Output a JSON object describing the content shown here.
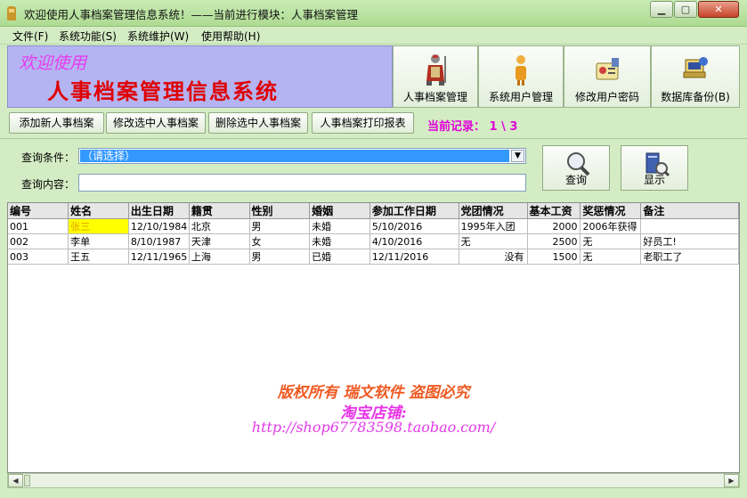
{
  "window": {
    "title": "欢迎使用人事档案管理信息系统！——当前进行模块：人事档案管理",
    "min_label": "▁",
    "max_label": "▢",
    "close_label": "✕"
  },
  "menu": [
    "文件(F)",
    "系统功能(S)",
    "系统维护(W)",
    "使用帮助(H)"
  ],
  "banner": {
    "welcome": "欢迎使用",
    "system_name": "人事档案管理信息系统"
  },
  "modules": [
    {
      "label": "人事档案管理",
      "icon": "person-knight-icon"
    },
    {
      "label": "系统用户管理",
      "icon": "user-figure-icon"
    },
    {
      "label": "修改用户密码",
      "icon": "password-card-icon"
    },
    {
      "label": "数据库备份(B)",
      "icon": "database-backup-icon"
    }
  ],
  "actions": {
    "add": "添加新人事档案",
    "edit": "修改选中人事档案",
    "delete": "删除选中人事档案",
    "print": "人事档案打印报表",
    "record_status": "当前记录： 1 \\ 3"
  },
  "query": {
    "condition_label": "查询条件：",
    "condition_value": "（请选择）",
    "content_label": "查询内容：",
    "content_value": "",
    "search_button": "查询",
    "show_button": "显示"
  },
  "table": {
    "columns": [
      "编号",
      "姓名",
      "出生日期",
      "籍贯",
      "性别",
      "婚姻",
      "参加工作日期",
      "党团情况",
      "基本工资",
      "奖惩情况",
      "备注"
    ],
    "rows": [
      [
        "001",
        "张三",
        "12/10/1984",
        "北京",
        "男",
        "未婚",
        "5/10/2016",
        "1995年入团",
        "2000",
        "2006年获得",
        ""
      ],
      [
        "002",
        "李单",
        "8/10/1987",
        "天津",
        "女",
        "未婚",
        "4/10/2016",
        "无",
        "2500",
        "无",
        "好员工!"
      ],
      [
        "003",
        "王五",
        "12/11/1965",
        "上海",
        "男",
        "已婚",
        "12/11/2016",
        "没有",
        "1500",
        "无",
        "老职工了"
      ]
    ]
  },
  "watermark": {
    "line1": "版权所有 瑞文软件 盗图必究",
    "line2": "淘宝店铺:",
    "line3": "http://shop67783598.taobao.com/"
  },
  "colors": {
    "banner_bg": "#b4b4f2",
    "title_red": "#e00000",
    "record_magenta": "#e000d8",
    "selection_blue": "#3399ff",
    "highlight_yellow": "#ffff00"
  }
}
